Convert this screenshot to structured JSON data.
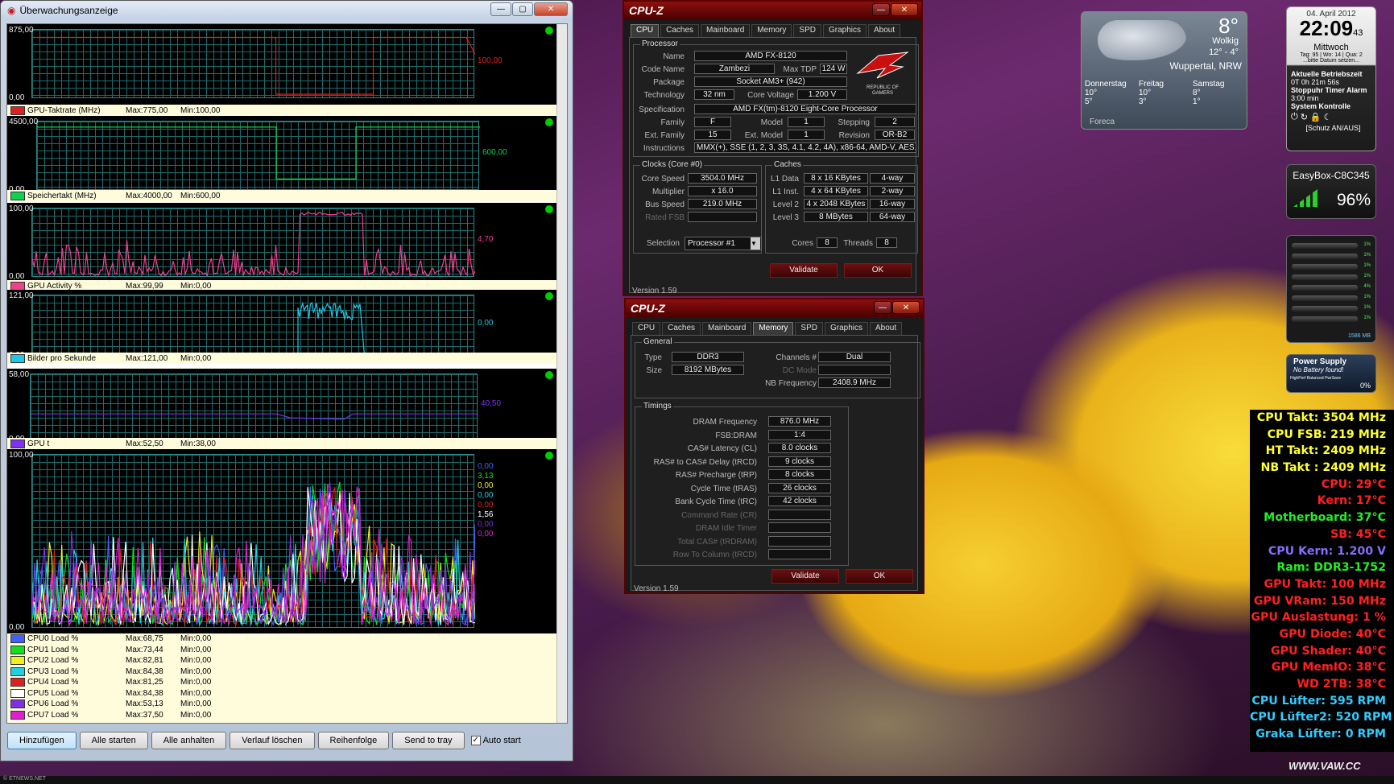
{
  "monitor": {
    "title": "Überwachungsanzeige",
    "controls": {
      "min": "—",
      "max": "▢",
      "close": "✕"
    },
    "graphs": [
      {
        "ymax": "875,00",
        "ymin": "0,00",
        "current": "100,00",
        "color": "#e02020",
        "legend": "GPU-Taktrate (MHz)",
        "max": "Max:775,00",
        "min": "Min:100,00"
      },
      {
        "ymax": "4500,00",
        "ymin": "0,00",
        "current": "600,00",
        "color": "#10d050",
        "legend": "Speichertakt (MHz)",
        "max": "Max:4000,00",
        "min": "Min:600,00"
      },
      {
        "ymax": "100,00",
        "ymin": "0,00",
        "current": "4,70",
        "color": "#f04090",
        "legend": "GPU Activity %",
        "max": "Max:99,99",
        "min": "Min:0,00"
      },
      {
        "ymax": "121,00",
        "ymin": "0,00",
        "current": "0,00",
        "color": "#20c8e8",
        "legend": "Bilder pro Sekunde",
        "max": "Max:121,00",
        "min": "Min:0,00"
      },
      {
        "ymax": "58,00",
        "ymin": "0,00",
        "current": "40,50",
        "color": "#8030f0",
        "legend": "GPU t",
        "max": "Max:52,50",
        "min": "Min:38,00"
      },
      {
        "ymax": "100,00",
        "ymin": "0,00",
        "current": "",
        "color": "#2040ff",
        "legend": "",
        "max": "",
        "min": ""
      }
    ],
    "cpu_currents": [
      "0,00",
      "3,13",
      "0,00",
      "0,00",
      "0,00",
      "1,56",
      "0,00",
      "0,00"
    ],
    "cpu_legend": [
      {
        "name": "CPU0 Load %",
        "max": "Max:68,75",
        "min": "Min:0,00",
        "color": "#4060ff"
      },
      {
        "name": "CPU1 Load %",
        "max": "Max:73,44",
        "min": "Min:0,00",
        "color": "#10e020"
      },
      {
        "name": "CPU2 Load %",
        "max": "Max:82,81",
        "min": "Min:0,00",
        "color": "#f0f020"
      },
      {
        "name": "CPU3 Load %",
        "max": "Max:84,38",
        "min": "Min:0,00",
        "color": "#20d0e0"
      },
      {
        "name": "CPU4 Load %",
        "max": "Max:81,25",
        "min": "Min:0,00",
        "color": "#e02020"
      },
      {
        "name": "CPU5 Load %",
        "max": "Max:84,38",
        "min": "Min:0,00",
        "color": "#ffffff"
      },
      {
        "name": "CPU6 Load %",
        "max": "Max:53,13",
        "min": "Min:0,00",
        "color": "#8030e0"
      },
      {
        "name": "CPU7 Load %",
        "max": "Max:37,50",
        "min": "Min:0,00",
        "color": "#e020d0"
      }
    ],
    "buttons": {
      "add": "Hinzufügen",
      "start_all": "Alle starten",
      "stop_all": "Alle anhalten",
      "clear_history": "Verlauf löschen",
      "order": "Reihenfolge",
      "send_tray": "Send to tray",
      "autostart": "Auto start",
      "autostart_checked": "✓"
    }
  },
  "cpuz1": {
    "title": "CPU-Z",
    "tabs": [
      "CPU",
      "Caches",
      "Mainboard",
      "Memory",
      "SPD",
      "Graphics",
      "About"
    ],
    "processor_group": "Processor",
    "labels": {
      "name": "Name",
      "code_name": "Code Name",
      "max_tdp": "Max TDP",
      "package": "Package",
      "technology": "Technology",
      "core_voltage": "Core Voltage",
      "specification": "Specification",
      "family": "Family",
      "model": "Model",
      "stepping": "Stepping",
      "ext_family": "Ext. Family",
      "ext_model": "Ext. Model",
      "revision": "Revision",
      "instructions": "Instructions",
      "clocks": "Clocks (Core #0)",
      "core_speed": "Core Speed",
      "multiplier": "Multiplier",
      "bus_speed": "Bus Speed",
      "rated_fsb": "Rated FSB",
      "caches": "Caches",
      "l1d": "L1 Data",
      "l1i": "L1 Inst.",
      "l2": "Level 2",
      "l3": "Level 3",
      "selection": "Selection",
      "cores": "Cores",
      "threads": "Threads"
    },
    "values": {
      "name": "AMD FX-8120",
      "code_name": "Zambezi",
      "max_tdp": "124 W",
      "package": "Socket AM3+ (942)",
      "technology": "32 nm",
      "core_voltage": "1.200 V",
      "specification": "AMD FX(tm)-8120 Eight-Core Processor",
      "family": "F",
      "model": "1",
      "stepping": "2",
      "ext_family": "15",
      "ext_model": "1",
      "revision": "OR-B2",
      "instructions": "MMX(+), SSE (1, 2, 3, 3S, 4.1, 4.2, 4A), x86-64, AMD-V, AES, A",
      "core_speed": "3504.0 MHz",
      "multiplier": "x 16.0",
      "bus_speed": "219.0 MHz",
      "rated_fsb": "",
      "l1d": "8 x 16 KBytes",
      "l1d_way": "4-way",
      "l1i": "4 x 64 KBytes",
      "l1i_way": "2-way",
      "l2": "4 x 2048 KBytes",
      "l2_way": "16-way",
      "l3": "8 MBytes",
      "l3_way": "64-way",
      "selection": "Processor #1",
      "cores": "8",
      "threads": "8"
    },
    "logo": "REPUBLIC OF GAMERS",
    "validate": "Validate",
    "ok": "OK",
    "version": "Version 1.59"
  },
  "cpuz2": {
    "title": "CPU-Z",
    "tabs": [
      "CPU",
      "Caches",
      "Mainboard",
      "Memory",
      "SPD",
      "Graphics",
      "About"
    ],
    "general": "General",
    "timings": "Timings",
    "labels": {
      "type": "Type",
      "size": "Size",
      "channels": "Channels #",
      "dc_mode": "DC Mode",
      "nb_freq": "NB Frequency",
      "dram_freq": "DRAM Frequency",
      "fsb_dram": "FSB:DRAM",
      "cl": "CAS# Latency (CL)",
      "trcd": "RAS# to CAS# Delay (tRCD)",
      "trp": "RAS# Precharge (tRP)",
      "tras": "Cycle Time (tRAS)",
      "trc": "Bank Cycle Time (tRC)",
      "cr": "Command Rate (CR)",
      "idle": "DRAM Idle Timer",
      "trdram": "Total CAS# (tRDRAM)",
      "trcd2": "Row To Column (tRCD)"
    },
    "values": {
      "type": "DDR3",
      "size": "8192 MBytes",
      "channels": "Dual",
      "dc_mode": "",
      "nb_freq": "2408.9 MHz",
      "dram_freq": "876.0 MHz",
      "fsb_dram": "1:4",
      "cl": "8.0 clocks",
      "trcd": "9 clocks",
      "trp": "8 clocks",
      "tras": "26 clocks",
      "trc": "42 clocks"
    },
    "validate": "Validate",
    "ok": "OK",
    "version": "Version 1.59"
  },
  "weather": {
    "temp": "8°",
    "cond": "Wolkig",
    "range": "12° - 4°",
    "city": "Wuppertal, NRW",
    "days": [
      {
        "d": "Donnerstag",
        "hi": "10°",
        "lo": "5°"
      },
      {
        "d": "Freitag",
        "hi": "10°",
        "lo": "3°"
      },
      {
        "d": "Samstag",
        "hi": "8°",
        "lo": "1°"
      }
    ],
    "source": "Foreca"
  },
  "clock": {
    "date": "04. April 2012",
    "time": "22:09",
    "sec": "43",
    "weekday": "Mittwoch",
    "info": "Tag: 95 | Wo: 14 | Qua: 2",
    "hint": "...bitte Datum setzen...",
    "uptime_label": "Aktuelle Betriebszeit",
    "uptime": "0T 0h 21m 56s",
    "alarm": "Stoppuhr Timer Alarm",
    "alarm_val": "3:00 min",
    "sys": "System Kontrolle",
    "protect": "[Schutz AN/AUS]"
  },
  "wifi": {
    "name": "EasyBox-C8C345",
    "pct": "96%"
  },
  "cores": {
    "total": "1586 MB",
    "vals": [
      "1%",
      "1%",
      "1%",
      "1%",
      "4%",
      "1%",
      "1%",
      "1%"
    ]
  },
  "power": {
    "title": "Power Supply",
    "sub": "No Battery found!",
    "plan": "HighPerf Balanced PwrSave",
    "pct": "0%"
  },
  "stats": [
    {
      "t": "CPU Takt: 3504 MHz",
      "c": "#ffff33"
    },
    {
      "t": "CPU FSB: 219 MHz",
      "c": "#ffff33"
    },
    {
      "t": "HT Takt: 2409 MHz",
      "c": "#ffff33"
    },
    {
      "t": "NB Takt : 2409 MHz",
      "c": "#ffff33"
    },
    {
      "t": "CPU: 29°C",
      "c": "#ff2020"
    },
    {
      "t": "Kern: 17°C",
      "c": "#ff2020"
    },
    {
      "t": "Motherboard: 37°C",
      "c": "#22ee22"
    },
    {
      "t": "SB: 45°C",
      "c": "#ff2020"
    },
    {
      "t": "CPU Kern: 1.200 V",
      "c": "#8a6cff"
    },
    {
      "t": "Ram: DDR3-1752",
      "c": "#22ee22"
    },
    {
      "t": "GPU Takt: 100 MHz",
      "c": "#ff2020"
    },
    {
      "t": "GPU VRam: 150 MHz",
      "c": "#ff2020"
    },
    {
      "t": "GPU Auslastung: 1 %",
      "c": "#ff2020"
    },
    {
      "t": "GPU Diode: 40°C",
      "c": "#ff2020"
    },
    {
      "t": "GPU Shader: 40°C",
      "c": "#ff2020"
    },
    {
      "t": "GPU MemIO: 38°C",
      "c": "#ff2020"
    },
    {
      "t": "WD 2TB: 38°C",
      "c": "#ff2020"
    },
    {
      "t": "CPU Lüfter: 595 RPM",
      "c": "#33ccff"
    },
    {
      "t": "CPU Lüfter2: 520 RPM",
      "c": "#33ccff"
    },
    {
      "t": "Graka Lüfter: 0 RPM",
      "c": "#33ccff"
    }
  ],
  "brand": "WWW.VAW.CC",
  "taskbar": "© ETNEWS.NET"
}
